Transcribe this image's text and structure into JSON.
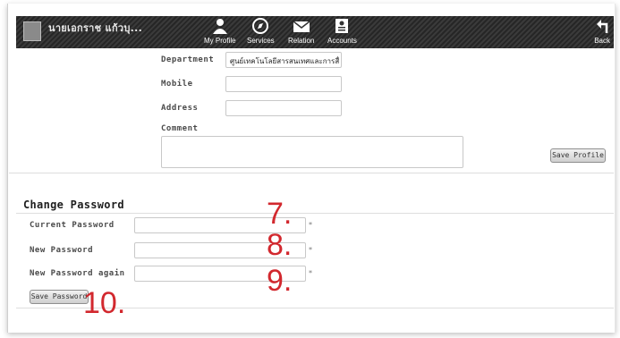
{
  "topbar": {
    "user_name": "นายเอกราช แก้วบุ...",
    "nav": [
      {
        "label": "My Profile",
        "icon": "user-icon"
      },
      {
        "label": "Services",
        "icon": "compass-icon"
      },
      {
        "label": "Relation",
        "icon": "envelope-icon"
      },
      {
        "label": "Accounts",
        "icon": "id-card-icon"
      }
    ],
    "back_label": "Back",
    "back_icon": "back-arrow-icon"
  },
  "profile": {
    "department_label": "Department",
    "department_value": "ศูนย์เทคโนโลยีสารสนเทศและการสื่อสาร",
    "mobile_label": "Mobile",
    "mobile_value": "",
    "address_label": "Address",
    "address_value": "",
    "comment_label": "Comment",
    "comment_value": "",
    "save_button": "Save Profile"
  },
  "change_password": {
    "title": "Change Password",
    "current_label": "Current Password",
    "new_label": "New Password",
    "again_label": "New Password again",
    "required_mark": "*",
    "save_button": "Save Password"
  },
  "annotations": {
    "step7": "7.",
    "step8": "8.",
    "step9": "9.",
    "step10": "10."
  },
  "colors": {
    "topbar": "#2c2c2c",
    "annotation": "#d2282e"
  }
}
